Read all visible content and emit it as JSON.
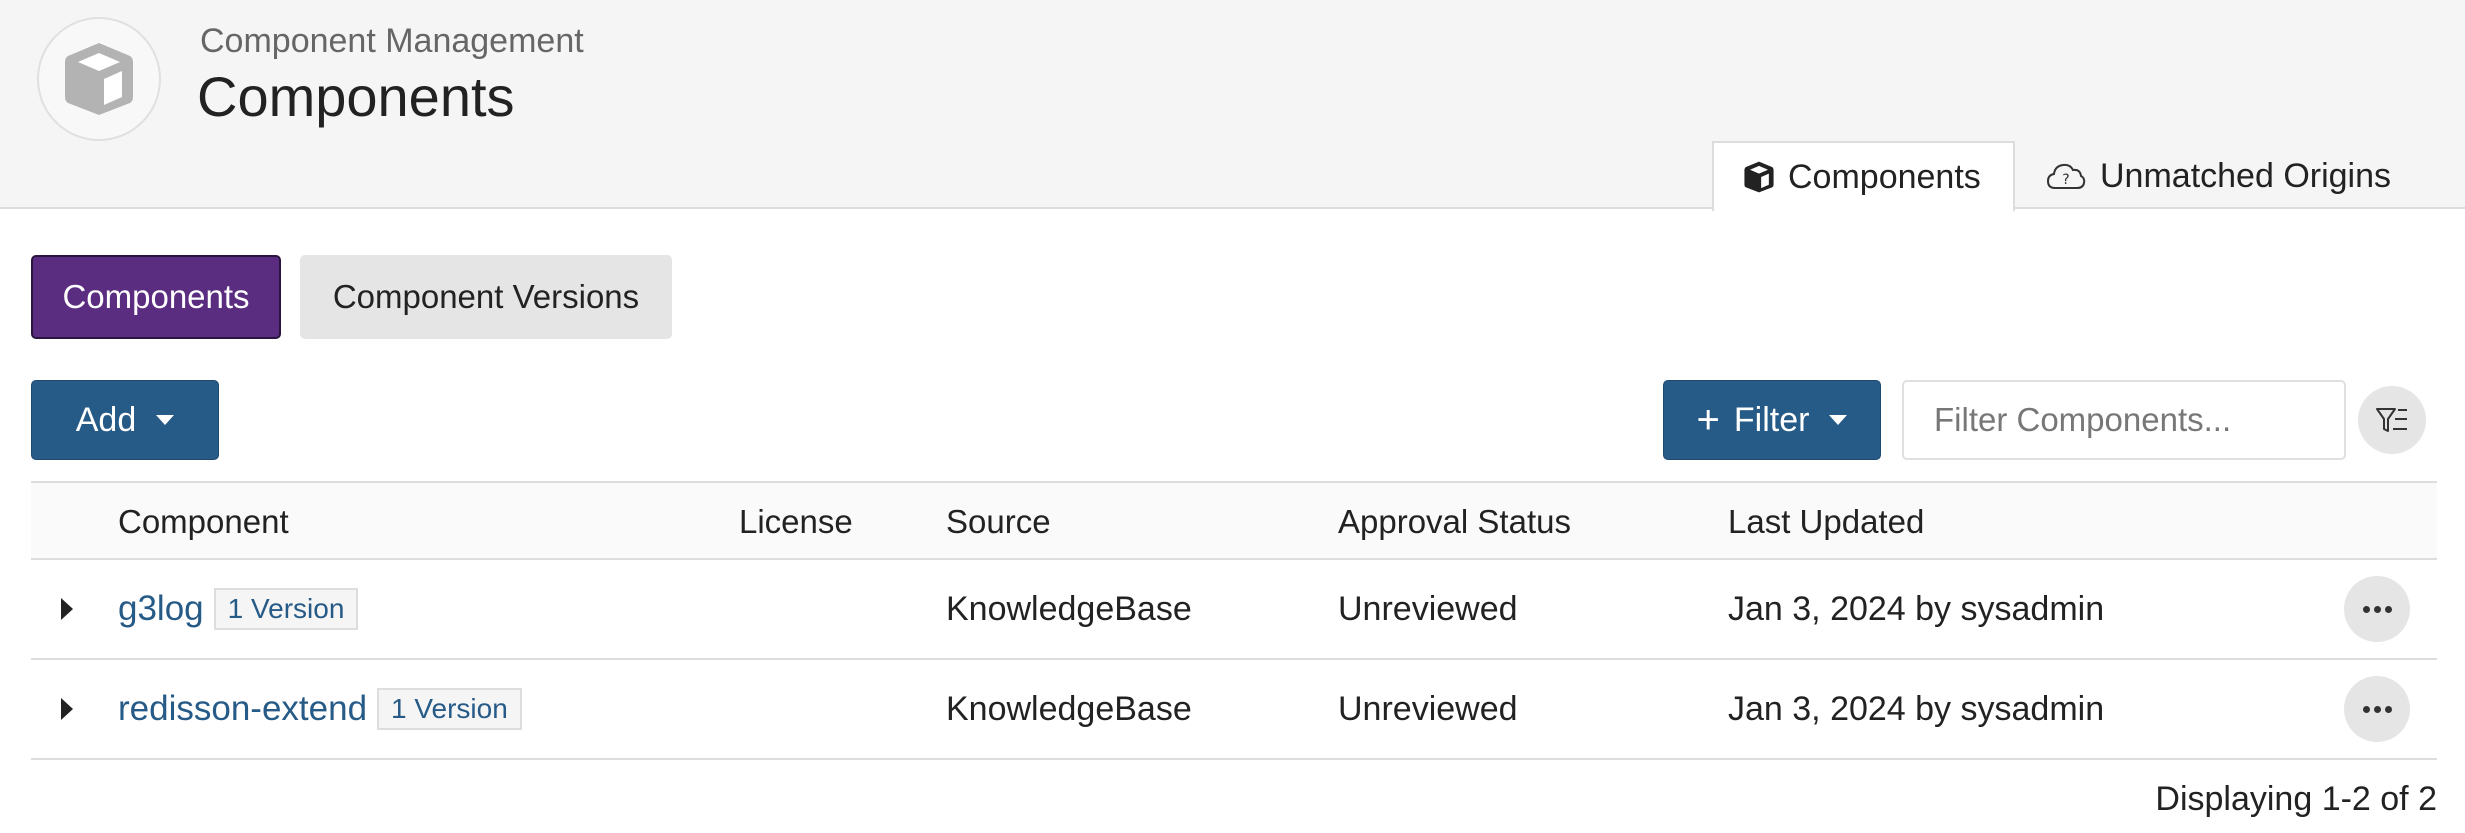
{
  "header": {
    "icon": "cube-icon",
    "subtitle": "Component Management",
    "title": "Components"
  },
  "tabs": [
    {
      "label": "Components",
      "icon": "cube-icon",
      "active": true
    },
    {
      "label": "Unmatched Origins",
      "icon": "cloud-question-icon",
      "active": false
    }
  ],
  "view_toggle": [
    {
      "label": "Components",
      "active": true
    },
    {
      "label": "Component Versions",
      "active": false
    }
  ],
  "toolbar": {
    "add_label": "Add",
    "filter_label": "Filter",
    "search_placeholder": "Filter Components...",
    "search_value": "",
    "filter_toggle_icon": "filter-list-icon"
  },
  "colors": {
    "primary": "#265a87",
    "active_toggle": "#5b2d80",
    "link": "#265a87"
  },
  "table": {
    "columns": [
      "Component",
      "License",
      "Source",
      "Approval Status",
      "Last Updated"
    ],
    "rows": [
      {
        "component": "g3log",
        "versions": "1 Version",
        "license": "",
        "source": "KnowledgeBase",
        "approval_status": "Unreviewed",
        "last_updated": "Jan 3, 2024 by sysadmin"
      },
      {
        "component": "redisson-extend",
        "versions": "1 Version",
        "license": "",
        "source": "KnowledgeBase",
        "approval_status": "Unreviewed",
        "last_updated": "Jan 3, 2024 by sysadmin"
      }
    ]
  },
  "pagination": {
    "summary": "Displaying 1-2 of 2"
  }
}
